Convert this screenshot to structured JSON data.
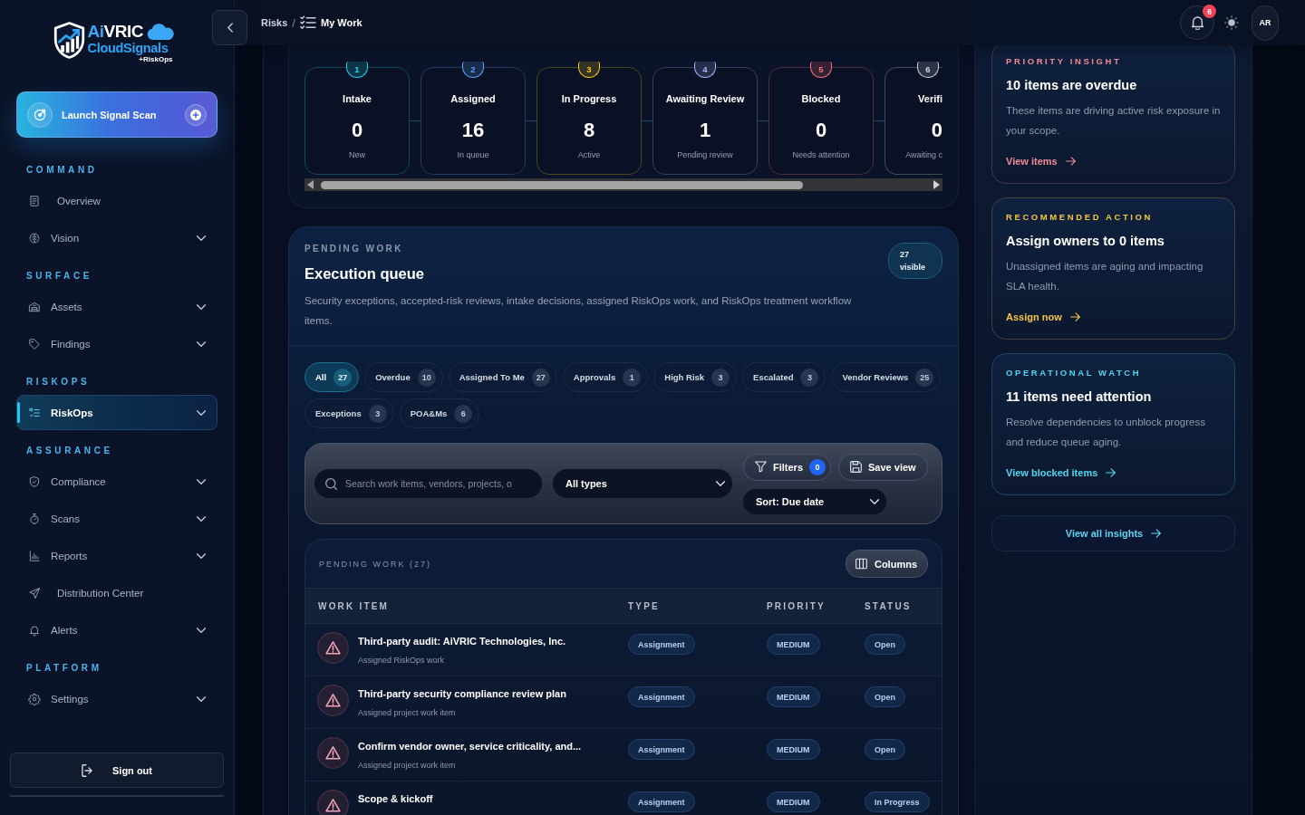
{
  "sidebar": {
    "brand": {
      "accent": "Ai",
      "name": "VRIC",
      "product": "CloudSignals",
      "edition": "+RiskOps"
    },
    "launch_button": "Launch Signal Scan",
    "sections": [
      {
        "title": "COMMAND",
        "items": [
          {
            "label": "Overview",
            "kind": "link",
            "selected": false
          },
          {
            "label": "Vision",
            "kind": "group",
            "selected": false
          }
        ]
      },
      {
        "title": "SURFACE",
        "items": [
          {
            "label": "Assets",
            "kind": "group",
            "selected": false
          },
          {
            "label": "Findings",
            "kind": "group",
            "selected": false
          }
        ]
      },
      {
        "title": "RISKOPS",
        "items": [
          {
            "label": "RiskOps",
            "kind": "group",
            "selected": true
          }
        ]
      },
      {
        "title": "ASSURANCE",
        "items": [
          {
            "label": "Compliance",
            "kind": "group",
            "selected": false
          },
          {
            "label": "Scans",
            "kind": "group",
            "selected": false
          },
          {
            "label": "Reports",
            "kind": "group",
            "selected": false
          },
          {
            "label": "Distribution Center",
            "kind": "link",
            "selected": false
          },
          {
            "label": "Alerts",
            "kind": "group",
            "selected": false
          }
        ]
      },
      {
        "title": "PLATFORM",
        "items": [
          {
            "label": "Settings",
            "kind": "group",
            "selected": false
          }
        ]
      }
    ],
    "sign_out": "Sign out"
  },
  "header": {
    "breadcrumb": [
      {
        "label": "Risks"
      },
      {
        "label": "My Work"
      }
    ],
    "separator": "/",
    "notifications": "6",
    "avatar": "AR"
  },
  "stages": [
    {
      "number": "1",
      "title": "Intake",
      "value": "0",
      "caption": "New",
      "color": "#22d3ee"
    },
    {
      "number": "2",
      "title": "Assigned",
      "value": "16",
      "caption": "In queue",
      "color": "#60a5fa"
    },
    {
      "number": "3",
      "title": "In Progress",
      "value": "8",
      "caption": "Active",
      "color": "#facc15"
    },
    {
      "number": "4",
      "title": "Awaiting Review",
      "value": "1",
      "caption": "Pending review",
      "color": "#a5b4fc"
    },
    {
      "number": "5",
      "title": "Blocked",
      "value": "0",
      "caption": "Needs attention",
      "color": "#fb7185"
    },
    {
      "number": "6",
      "title": "Verifi",
      "value": "0",
      "caption": "Awaiting c",
      "color": "#cbd5e1"
    }
  ],
  "queue": {
    "eyebrow": "PENDING WORK",
    "title": "Execution queue",
    "description": "Security exceptions, accepted-risk reviews, intake decisions, assigned RiskOps work, and RiskOps treatment workflow items.",
    "visible_count": "27 visible",
    "filters": [
      {
        "label": "All",
        "count": "27",
        "selected": true
      },
      {
        "label": "Overdue",
        "count": "10",
        "selected": false
      },
      {
        "label": "Assigned To Me",
        "count": "27",
        "selected": false
      },
      {
        "label": "Approvals",
        "count": "1",
        "selected": false
      },
      {
        "label": "High Risk",
        "count": "3",
        "selected": false
      },
      {
        "label": "Escalated",
        "count": "3",
        "selected": false
      },
      {
        "label": "Vendor Reviews",
        "count": "25",
        "selected": false
      },
      {
        "label": "Exceptions",
        "count": "3",
        "selected": false
      },
      {
        "label": "POA&Ms",
        "count": "6",
        "selected": false
      }
    ],
    "search": {
      "placeholder": "Search work items, vendors, projects, o"
    },
    "type_select": "All types",
    "filters_button": {
      "label": "Filters",
      "count": "0"
    },
    "save_view": "Save view",
    "sort_select": "Sort: Due date"
  },
  "table": {
    "eyebrow": "PENDING WORK (27)",
    "columns_button": "Columns",
    "columns": [
      "WORK ITEM",
      "TYPE",
      "PRIORITY",
      "STATUS"
    ],
    "rows": [
      {
        "title": "Third-party audit: AiVRIC Technologies, Inc.",
        "subtitle": "Assigned RiskOps work",
        "type": "Assignment",
        "priority": "MEDIUM",
        "status": "Open"
      },
      {
        "title": "Third-party security compliance review plan",
        "subtitle": "Assigned project work item",
        "type": "Assignment",
        "priority": "MEDIUM",
        "status": "Open"
      },
      {
        "title": "Confirm vendor owner, service criticality, and...",
        "subtitle": "Assigned project work item",
        "type": "Assignment",
        "priority": "MEDIUM",
        "status": "Open"
      },
      {
        "title": "Scope & kickoff",
        "type": "Assignment",
        "priority": "MEDIUM",
        "status": "In Progress"
      }
    ]
  },
  "insights": {
    "cards": [
      {
        "eyebrow": "PRIORITY INSIGHT",
        "title": "10 items are overdue",
        "body": "These items are driving active risk exposure in your scope.",
        "link": "View items",
        "color": "#f4899a"
      },
      {
        "eyebrow": "RECOMMENDED ACTION",
        "title": "Assign owners to 0 items",
        "body": "Unassigned items are aging and impacting SLA health.",
        "link": "Assign now",
        "color": "#f5c542"
      },
      {
        "eyebrow": "OPERATIONAL WATCH",
        "title": "11 items need attention",
        "body": "Resolve dependencies to unblock progress and reduce queue aging.",
        "link": "View blocked items",
        "color": "#4fd6f2"
      }
    ],
    "view_all": "View all insights"
  }
}
